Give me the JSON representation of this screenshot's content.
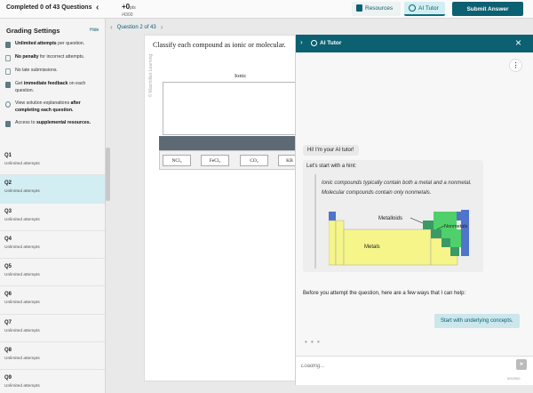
{
  "topbar": {
    "progress": "Completed 0 of 43 Questions",
    "collapse_icon": "‹",
    "points_value": "+0",
    "points_unit": "pts",
    "points_sub": "/4300",
    "resources_label": "Resources",
    "ai_tutor_label": "AI Tutor",
    "submit_label": "Submit Answer"
  },
  "sidebar": {
    "title": "Grading Settings",
    "hide_label": "Hide",
    "settings": [
      {
        "bold": "Unlimited attempts",
        "rest": " per question.",
        "icon": "unlimited-icon"
      },
      {
        "bold": "No penalty",
        "rest": " for incorrect attempts.",
        "icon": "no-penalty-icon"
      },
      {
        "bold": "",
        "rest": "No late submissions.",
        "icon": "calendar-icon"
      },
      {
        "pre": "Get ",
        "bold": "immediate feedback",
        "rest": " on each question.",
        "icon": "feedback-icon"
      },
      {
        "pre": "View solution explanations ",
        "bold": "after completing each question.",
        "rest": "",
        "icon": "lightbulb-icon"
      },
      {
        "pre": "Access to ",
        "bold": "supplemental resources.",
        "rest": "",
        "icon": "book-icon"
      }
    ],
    "questions": [
      {
        "name": "Q1",
        "sub": "Unlimited attempts"
      },
      {
        "name": "Q2",
        "sub": "Unlimited attempts",
        "active": true
      },
      {
        "name": "Q3",
        "sub": "Unlimited attempts"
      },
      {
        "name": "Q4",
        "sub": "Unlimited attempts"
      },
      {
        "name": "Q5",
        "sub": "Unlimited attempts"
      },
      {
        "name": "Q6",
        "sub": "Unlimited attempts"
      },
      {
        "name": "Q7",
        "sub": "Unlimited attempts"
      },
      {
        "name": "Q8",
        "sub": "Unlimited attempts"
      },
      {
        "name": "Q9",
        "sub": "Unlimited attempts"
      }
    ]
  },
  "question": {
    "nav_label": "Question 2 of 43",
    "watermark": "© Macmillan Learning",
    "prompt": "Classify each compound as ionic or molecular.",
    "ionic_label": "Ionic",
    "chips": [
      "NCl₃",
      "FeCl₃",
      "CO₂",
      "KB"
    ]
  },
  "ai_panel": {
    "title": "AI Tutor",
    "greeting": "Hi! I'm your AI tutor!",
    "hint_intro": "Let's start with a hint:",
    "hint_text": "Ionic compounds typically contain both a metal and a nonmetal. Molecular compounds contain only nonmetals.",
    "table_labels": {
      "metalloids": "Metalloids",
      "nonmetals": "Nonmetals",
      "metals": "Metals"
    },
    "help_text": "Before you attempt the question, here are a few ways that I can help:",
    "suggestion": "Start with underlying concepts.",
    "typing": "• • •",
    "input_placeholder": "Loading...",
    "char_count": "500/500",
    "colors": {
      "metals": "#f5f58a",
      "nonmetals": "#4fd06a",
      "metalloids": "#3a9a66",
      "alkali": "#4f74c9"
    }
  }
}
